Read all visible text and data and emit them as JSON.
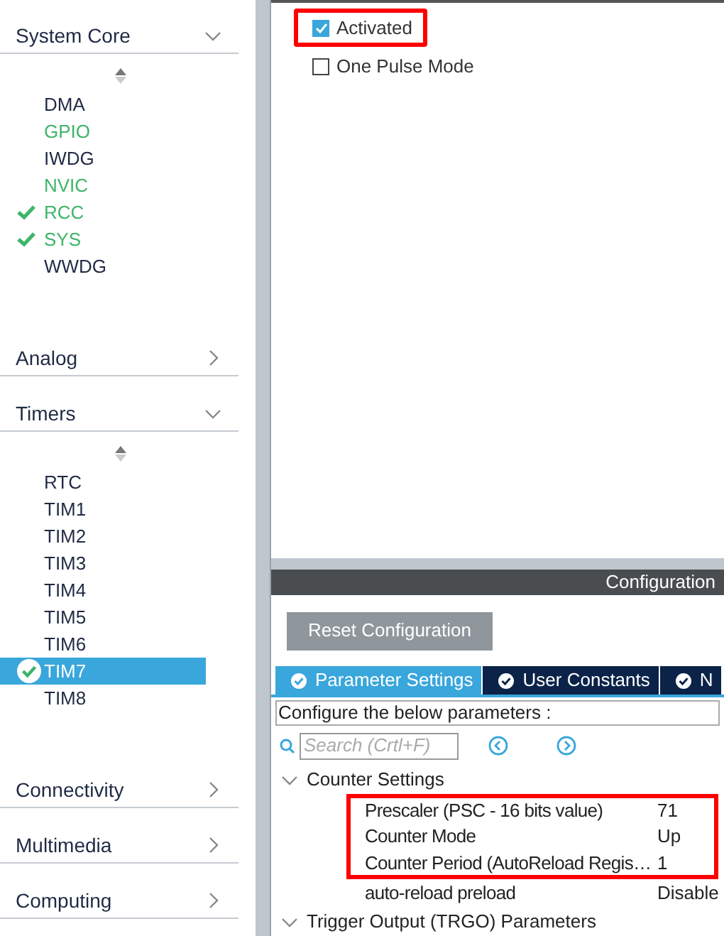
{
  "sidebar": {
    "categories": [
      {
        "label": "System Core",
        "expanded": true,
        "items": [
          {
            "label": "DMA",
            "kind": "plain",
            "selected": false
          },
          {
            "label": "GPIO",
            "kind": "partial",
            "selected": false
          },
          {
            "label": "IWDG",
            "kind": "plain",
            "selected": false
          },
          {
            "label": "NVIC",
            "kind": "partial",
            "selected": false
          },
          {
            "label": "RCC",
            "kind": "ok",
            "selected": false
          },
          {
            "label": "SYS",
            "kind": "ok",
            "selected": false
          },
          {
            "label": "WWDG",
            "kind": "plain",
            "selected": false
          }
        ]
      },
      {
        "label": "Analog",
        "expanded": false
      },
      {
        "label": "Timers",
        "expanded": true,
        "items": [
          {
            "label": "RTC",
            "kind": "plain",
            "selected": false
          },
          {
            "label": "TIM1",
            "kind": "plain",
            "selected": false
          },
          {
            "label": "TIM2",
            "kind": "plain",
            "selected": false
          },
          {
            "label": "TIM3",
            "kind": "plain",
            "selected": false
          },
          {
            "label": "TIM4",
            "kind": "plain",
            "selected": false
          },
          {
            "label": "TIM5",
            "kind": "plain",
            "selected": false
          },
          {
            "label": "TIM6",
            "kind": "plain",
            "selected": false
          },
          {
            "label": "TIM7",
            "kind": "ok",
            "selected": true
          },
          {
            "label": "TIM8",
            "kind": "plain",
            "selected": false
          }
        ]
      },
      {
        "label": "Connectivity",
        "expanded": false
      },
      {
        "label": "Multimedia",
        "expanded": false
      },
      {
        "label": "Computing",
        "expanded": false
      }
    ]
  },
  "mode": {
    "options": [
      {
        "label": "Activated",
        "checked": true,
        "highlighted": true
      },
      {
        "label": "One Pulse Mode",
        "checked": false,
        "highlighted": false
      }
    ]
  },
  "configuration": {
    "title": "Configuration",
    "reset_button": "Reset Configuration",
    "tabs": [
      {
        "label": "Parameter Settings",
        "selected": true
      },
      {
        "label": "User Constants",
        "selected": false
      },
      {
        "label": "N",
        "selected": false
      }
    ],
    "hint": "Configure the below parameters :",
    "search": {
      "placeholder": "Search (Crtl+F)"
    },
    "groups": [
      {
        "label": "Counter Settings",
        "expanded": true,
        "rows": [
          {
            "name": "Prescaler (PSC - 16 bits value)",
            "value": "71",
            "highlighted": true
          },
          {
            "name": "Counter Mode",
            "value": "Up",
            "highlighted": true
          },
          {
            "name": "Counter Period (AutoReload Regis…",
            "value": "1",
            "highlighted": true
          },
          {
            "name": "auto-reload preload",
            "value": "Disable",
            "highlighted": false
          }
        ]
      },
      {
        "label": "Trigger Output (TRGO) Parameters",
        "expanded": true
      }
    ]
  }
}
